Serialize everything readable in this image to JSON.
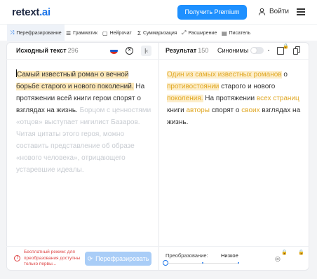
{
  "header": {
    "logo_main": "retext",
    "logo_suffix": ".ai",
    "premium_label": "Получить Premium",
    "login_label": "Войти"
  },
  "tools": [
    {
      "label": "Перефразирование",
      "icon": "shuffle-icon"
    },
    {
      "label": "Грамматик",
      "icon": "grammar-icon"
    },
    {
      "label": "Нейрочат",
      "icon": "chat-icon"
    },
    {
      "label": "Суммаризация",
      "icon": "sigma-icon"
    },
    {
      "label": "Расширение",
      "icon": "expand-icon"
    },
    {
      "label": "Писатель",
      "icon": "writer-icon"
    }
  ],
  "source": {
    "title": "Исходный текст",
    "count": "296",
    "text_highlighted": "Самый известный роман о вечной борьбе старого и нового поколений.",
    "text_normal": " На протяжении всей книги герои спорят о взглядах на жизнь.",
    "text_faded": " Борцом с ценностями «отцов» выступает нигилист Базаров. Читая цитаты этого героя, можно составить представление об образе «нового человека», отрицающего устаревшие идеалы."
  },
  "result": {
    "title": "Результат",
    "count": "150",
    "synonyms_label": "Синонимы",
    "segments": [
      {
        "text": "Один из самых известных романов",
        "style": "chb"
      },
      {
        "text": " о ",
        "style": "n"
      },
      {
        "text": "противостоянии",
        "style": "chb"
      },
      {
        "text": " старого и нового ",
        "style": "n"
      },
      {
        "text": "поколения.",
        "style": "chb"
      },
      {
        "text": " На протяжении ",
        "style": "n"
      },
      {
        "text": "всех страниц",
        "style": "ch"
      },
      {
        "text": " книги ",
        "style": "n"
      },
      {
        "text": "авторы",
        "style": "ch"
      },
      {
        "text": " спорят о ",
        "style": "n"
      },
      {
        "text": "своих",
        "style": "ch"
      },
      {
        "text": " взглядах на жизнь.",
        "style": "n"
      }
    ]
  },
  "footer": {
    "warning": "Бесплатный режим: для преобразования доступны только первы...",
    "paraphrase_button": "Перефразировать",
    "mode_label": "Преобразование:",
    "mode_value": "Низкое",
    "mode_level_index": 0,
    "mode_levels": 4
  },
  "colors": {
    "accent": "#1e90ff",
    "highlight": "#fde8b8",
    "changed_text": "#e0a826",
    "warning": "#dd4444"
  }
}
